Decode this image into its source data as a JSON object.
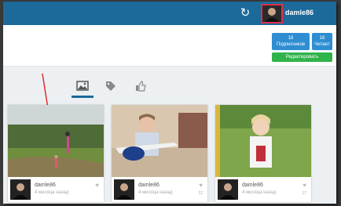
{
  "header": {
    "username": "damle86",
    "refresh_icon": "refresh-icon"
  },
  "profile": {
    "followers_count": "18",
    "followers_label": "Подписчиков",
    "reading_count": "16",
    "reading_label": "Читает",
    "edit_label": "Редактировать"
  },
  "tabs": [
    {
      "icon": "image-icon",
      "active": true
    },
    {
      "icon": "tag-icon",
      "active": false
    },
    {
      "icon": "thumbs-up-icon",
      "active": false
    }
  ],
  "cards": [
    {
      "user": "damle86",
      "time": "4 месяца назад",
      "count": ""
    },
    {
      "user": "damle86",
      "time": "4 месяца назад",
      "count": "12"
    },
    {
      "user": "damle86",
      "time": "4 месяца назад",
      "count": "17"
    }
  ],
  "colors": {
    "header_bg": "#1b6a9a",
    "stat_bg": "#2f8ed1",
    "edit_bg": "#2fb34b",
    "annotation_arrow": "#e0302a"
  }
}
